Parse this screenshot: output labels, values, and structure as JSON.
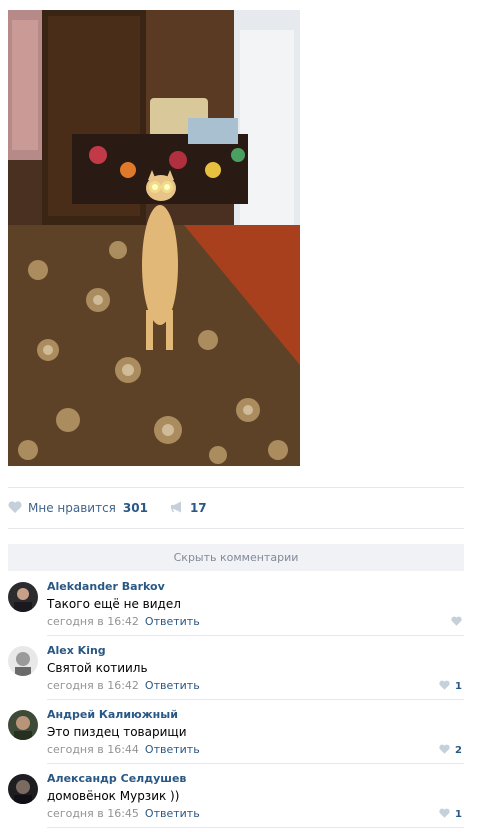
{
  "post": {
    "image_alt": "cat standing on hind legs on carpet with glowing eyes",
    "likes_label": "Мне нравится",
    "likes_count": "301",
    "reposts_count": "17",
    "icons": {
      "like": "heart-icon",
      "repost": "megaphone-icon"
    }
  },
  "comments_section": {
    "hide_label": "Скрыть комментарии",
    "items": [
      {
        "author": "Alekdander Barkov",
        "text": "Такого ещё не видел",
        "time": "сегодня в 16:42",
        "reply": "Ответить",
        "likes": ""
      },
      {
        "author": "Alex King",
        "text": "Святой котииль",
        "time": "сегодня в 16:42",
        "reply": "Ответить",
        "likes": "1"
      },
      {
        "author": "Андрей Калиюжный",
        "text": "Это пиздец товарищи",
        "time": "сегодня в 16:44",
        "reply": "Ответить",
        "likes": "2"
      },
      {
        "author": "Александр Селдушев",
        "text": "домовёнок Мурзик ))",
        "time": "сегодня в 16:45",
        "reply": "Ответить",
        "likes": "1"
      }
    ]
  },
  "colors": {
    "link": "#2a5885",
    "muted": "#939393",
    "bar_bg": "#f0f2f5",
    "icon": "#c5d0db"
  }
}
